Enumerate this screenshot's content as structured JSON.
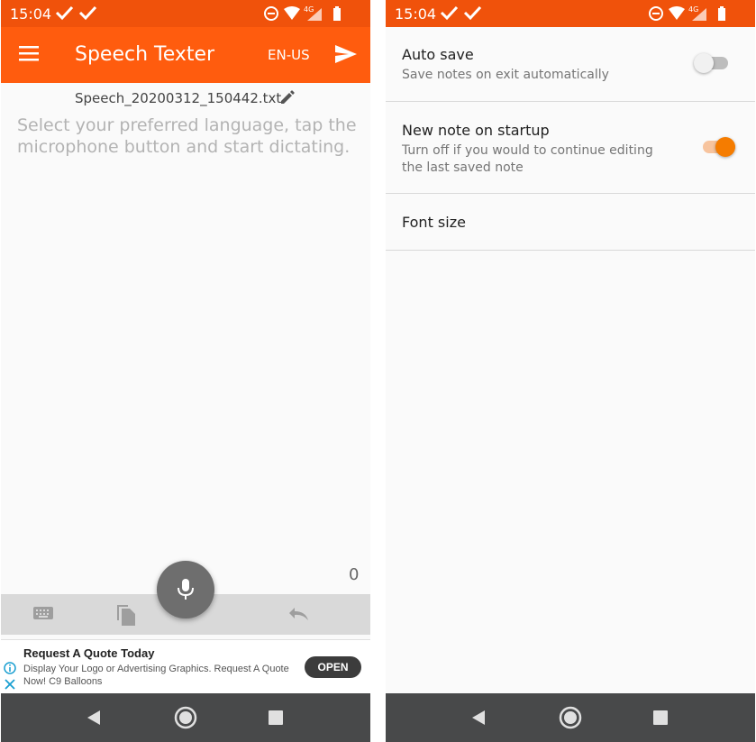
{
  "left_screen": {
    "status_bar": {
      "time": "15:04"
    },
    "app_bar": {
      "title": "Speech Texter",
      "language": "EN-US"
    },
    "document": {
      "filename": "Speech_20200312_150442.txt",
      "placeholder": "Select your preferred language, tap the microphone button and start dictating.",
      "word_count": "0"
    },
    "ad": {
      "title": "Request A Quote Today",
      "body": "Display Your Logo or Advertising Graphics. Request A Quote Now! C9 Balloons",
      "open_label": "OPEN"
    }
  },
  "right_screen": {
    "status_bar": {
      "time": "15:04"
    },
    "settings": [
      {
        "title": "Auto save",
        "subtitle": "Save notes on exit automatically",
        "enabled": false
      },
      {
        "title": "New note on startup",
        "subtitle": "Turn off if you would to continue editing the last saved note",
        "enabled": true
      },
      {
        "title": "Font size"
      }
    ]
  },
  "colors": {
    "status_bar": "#f0520b",
    "app_bar": "#ff5c0e",
    "accent": "#f57c00",
    "nav_bar": "#48494a",
    "toolbar": "#d9d9d9",
    "mic_button": "#6e6e6e"
  },
  "icons": [
    "menu-icon",
    "send-icon",
    "edit-icon",
    "keyboard-icon",
    "copy-icon",
    "undo-icon",
    "mic-icon",
    "info-icon",
    "close-icon",
    "back-icon",
    "home-icon",
    "recents-icon",
    "check-icon",
    "dnd-icon",
    "wifi-icon",
    "signal-icon",
    "battery-icon"
  ]
}
